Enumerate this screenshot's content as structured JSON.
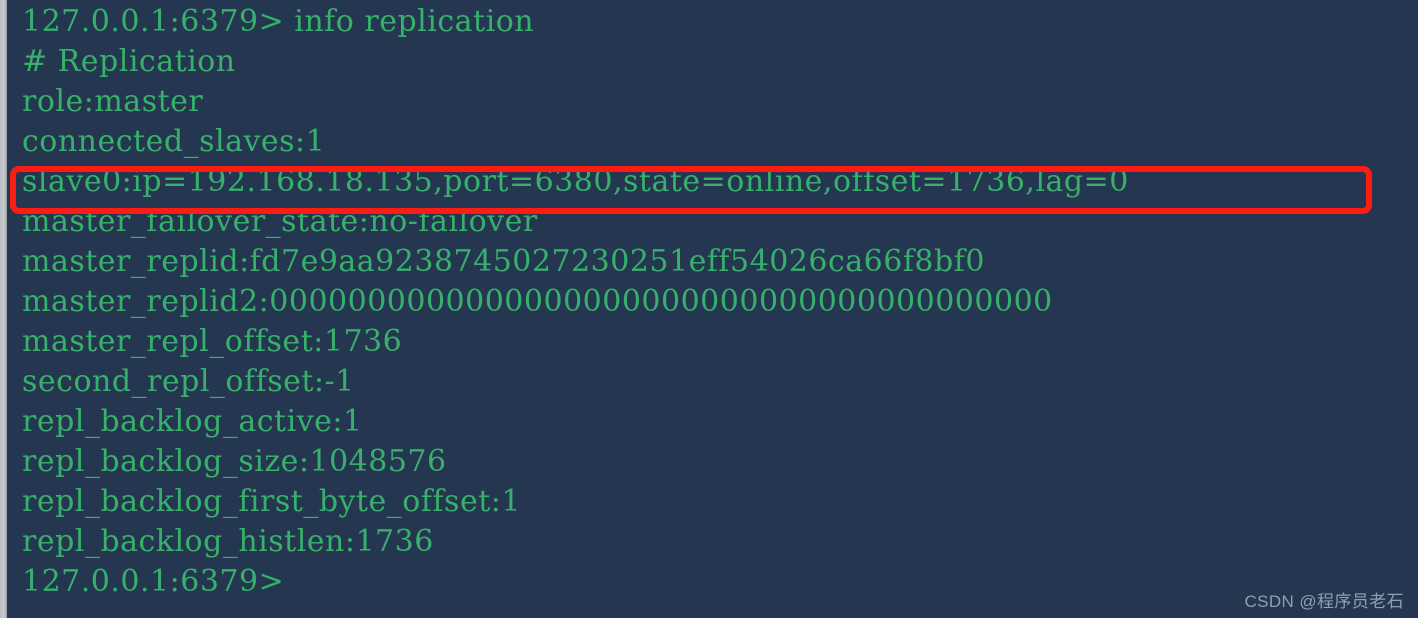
{
  "terminal": {
    "background_color": "#253750",
    "text_color": "#36b06b",
    "prompt": "127.0.0.1:6379>",
    "command": "info replication",
    "lines": [
      "127.0.0.1:6379> info replication",
      "# Replication",
      "role:master",
      "connected_slaves:1",
      "slave0:ip=192.168.18.135,port=6380,state=online,offset=1736,lag=0",
      "master_failover_state:no-failover",
      "master_replid:fd7e9aa9238745027230251eff54026ca66f8bf0",
      "master_replid2:0000000000000000000000000000000000000000",
      "master_repl_offset:1736",
      "second_repl_offset:-1",
      "repl_backlog_active:1",
      "repl_backlog_size:1048576",
      "repl_backlog_first_byte_offset:1",
      "repl_backlog_histlen:1736",
      "127.0.0.1:6379>"
    ],
    "fields": {
      "role": "master",
      "connected_slaves": "1",
      "slave0": {
        "ip": "192.168.18.135",
        "port": "6380",
        "state": "online",
        "offset": "1736",
        "lag": "0"
      },
      "master_failover_state": "no-failover",
      "master_replid": "fd7e9aa9238745027230251eff54026ca66f8bf0",
      "master_replid2": "0000000000000000000000000000000000000000",
      "master_repl_offset": "1736",
      "second_repl_offset": "-1",
      "repl_backlog_active": "1",
      "repl_backlog_size": "1048576",
      "repl_backlog_first_byte_offset": "1",
      "repl_backlog_histlen": "1736"
    },
    "section_header": "# Replication"
  },
  "annotation": {
    "color": "#fb1c13",
    "target_line": "slave0:ip=192.168.18.135,port=6380,state=online,offset=1736,lag=0"
  },
  "watermark": {
    "text": "CSDN @程序员老石"
  }
}
